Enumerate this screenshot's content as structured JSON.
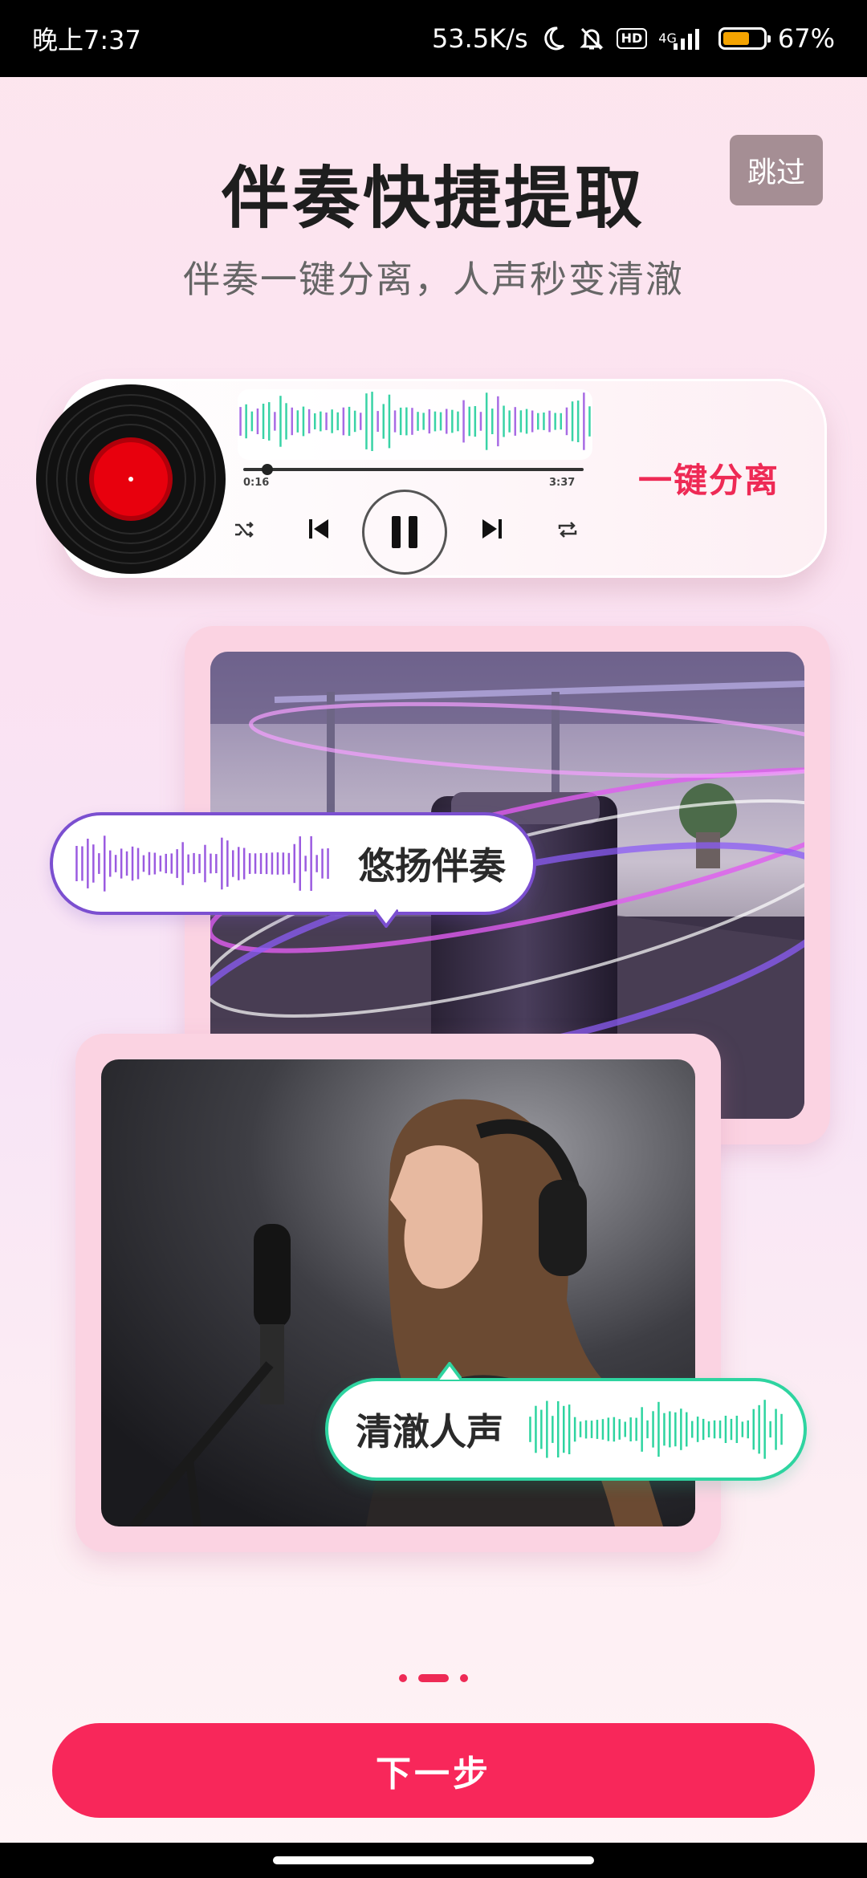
{
  "status_bar": {
    "time": "晚上7:37",
    "net_speed": "53.5K/s",
    "hd": "HD",
    "network": "4G",
    "battery_percent": "67%",
    "battery_level": 0.67,
    "icons": [
      "moon-icon",
      "mute-bell-icon",
      "hd-icon",
      "signal-icon",
      "battery-icon"
    ]
  },
  "header": {
    "title": "伴奏快捷提取",
    "subtitle": "伴奏一键分离，人声秒变清澈",
    "skip_label": "跳过"
  },
  "player": {
    "time_elapsed": "0:16",
    "time_total": "3:37",
    "progress": 0.07,
    "action_label": "一键分离",
    "controls": [
      "shuffle-icon",
      "previous-icon",
      "pause-icon",
      "next-icon",
      "repeat-icon"
    ]
  },
  "cards": {
    "accompaniment_label": "悠扬伴奏",
    "vocal_label": "清澈人声"
  },
  "pager": {
    "count": 3,
    "active_index": 1
  },
  "footer": {
    "next_label": "下一步"
  },
  "colors": {
    "accent": "#f8275a",
    "accent_text": "#ee2a55",
    "skip_bg": "#a58e94",
    "wave_purple": "#9b5be0",
    "wave_green": "#2ed4a0",
    "vinyl_red": "#e8000d"
  }
}
